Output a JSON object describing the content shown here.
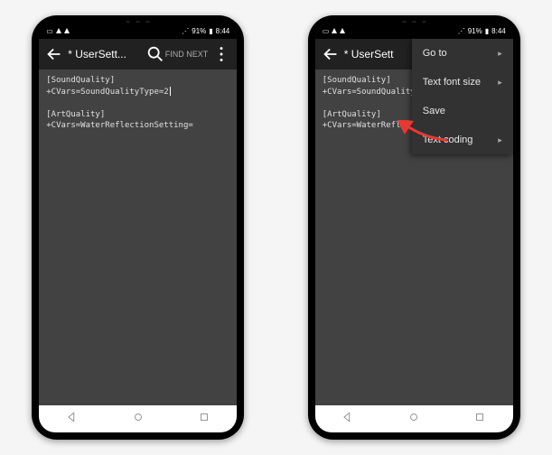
{
  "status": {
    "battery": "91%",
    "time": "8:44"
  },
  "header": {
    "title_full": "* UserSett...",
    "title_cut": "* UserSett",
    "find_next": "FIND NEXT"
  },
  "editor": {
    "line1": "[SoundQuality]",
    "line2_full": "+CVars=SoundQualityType=2",
    "line2_cut": "+CVars=SoundQualityTy",
    "line3": "[ArtQuality]",
    "line4_full": "+CVars=WaterReflectionSetting=",
    "line4_cut": "+CVars=WaterReflection"
  },
  "menu": {
    "items": [
      {
        "label": "Go to",
        "has_sub": true
      },
      {
        "label": "Text font size",
        "has_sub": true
      },
      {
        "label": "Save",
        "has_sub": false
      },
      {
        "label": "Text coding",
        "has_sub": true
      }
    ]
  }
}
